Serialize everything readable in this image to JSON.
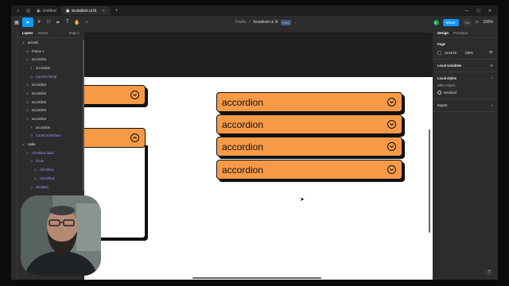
{
  "tabs": {
    "home_icon": "home-icon",
    "tab1": "Untitled",
    "tab2": "brutalism ui lit",
    "new_tab": "+"
  },
  "window": {
    "minimize": "—",
    "maximize": "☐",
    "close": "✕"
  },
  "toolbar": {
    "breadcrumb_drafts": "Drafts",
    "breadcrumb_sep": "/",
    "file_name": "brutalism ui lit",
    "plan_badge": "Free",
    "avatar_letter": "E",
    "share_label": "Share",
    "zoom": "335%"
  },
  "left_panel": {
    "tab_layers": "Layers",
    "tab_assets": "Assets",
    "page_label": "Page 1",
    "layers": [
      {
        "label": "accord",
        "indent": 0,
        "icon": "#",
        "style": "bold"
      },
      {
        "label": "Frame 1",
        "indent": 1,
        "icon": "#",
        "style": ""
      },
      {
        "label": "accordion",
        "indent": 1,
        "icon": "◇",
        "style": ""
      },
      {
        "label": "accordion",
        "indent": 2,
        "icon": "T",
        "style": ""
      },
      {
        "label": "CaretCircleUp",
        "indent": 2,
        "icon": "◇",
        "style": "purple"
      },
      {
        "label": "accordion",
        "indent": 1,
        "icon": "◇",
        "style": ""
      },
      {
        "label": "accordion",
        "indent": 1,
        "icon": "◇",
        "style": ""
      },
      {
        "label": "accordion",
        "indent": 1,
        "icon": "◇",
        "style": ""
      },
      {
        "label": "accordion",
        "indent": 1,
        "icon": "◇",
        "style": ""
      },
      {
        "label": "accordion",
        "indent": 1,
        "icon": "◇",
        "style": ""
      },
      {
        "label": "accordion",
        "indent": 2,
        "icon": "T",
        "style": ""
      },
      {
        "label": "CaretCircleDown",
        "indent": 2,
        "icon": "◇",
        "style": "purple"
      },
      {
        "label": "radio",
        "indent": 0,
        "icon": "#",
        "style": "bold"
      },
      {
        "label": "checkbox label",
        "indent": 1,
        "icon": "◇",
        "style": "purple"
      },
      {
        "label": "focus",
        "indent": 2,
        "icon": "◇",
        "style": "purple"
      },
      {
        "label": "checkbox",
        "indent": 3,
        "icon": "◇",
        "style": "purple"
      },
      {
        "label": "Checkbox",
        "indent": 3,
        "icon": "◇",
        "style": "purple"
      },
      {
        "label": "disabled",
        "indent": 2,
        "icon": "◇",
        "style": "purple"
      }
    ]
  },
  "canvas": {
    "accordions": [
      {
        "label": "accordion",
        "state": "collapsed"
      },
      {
        "label": "accordion",
        "state": "collapsed"
      },
      {
        "label": "accordion",
        "state": "collapsed"
      },
      {
        "label": "accordion",
        "state": "collapsed"
      }
    ],
    "accent": "#f79a47"
  },
  "right_panel": {
    "tab_design": "Design",
    "tab_prototype": "Prototype",
    "page_heading": "Page",
    "page_color": "1E1E1E",
    "page_opacity": "100%",
    "local_variables": "Local variables",
    "local_styles": "Local styles",
    "effect_styles": "Effect styles",
    "effect_name": "standard",
    "export": "Export"
  },
  "help": "?"
}
